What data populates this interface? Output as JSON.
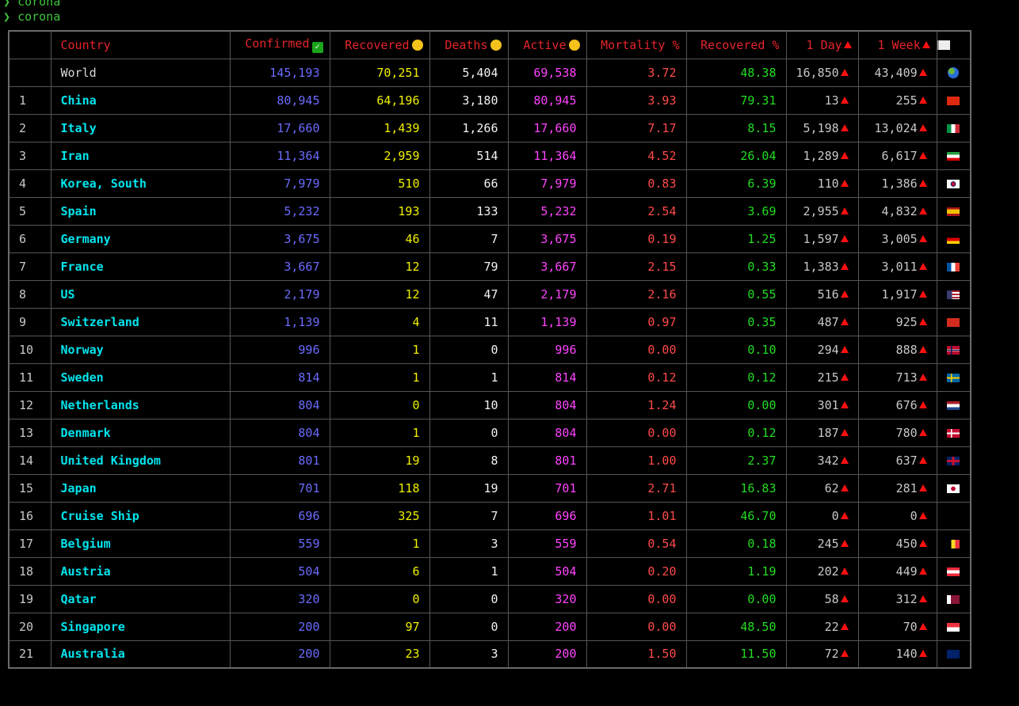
{
  "terminal": {
    "prompt_symbol": "❯",
    "lines": [
      "corona",
      "corona"
    ]
  },
  "table": {
    "headers": {
      "rank": "",
      "country": "Country",
      "confirmed": "Confirmed",
      "confirmed_icon": "check-mark-icon",
      "recovered": "Recovered",
      "recovered_icon": "smiley-face-icon",
      "deaths": "Deaths",
      "deaths_icon": "sad-face-icon",
      "active": "Active",
      "active_icon": "mask-face-icon",
      "mortality": "Mortality %",
      "recovered_pct": "Recovered %",
      "one_day": "1 Day",
      "one_week": "1 Week",
      "flag_icon": "white-flag-icon"
    },
    "rows": [
      {
        "rank": "",
        "country": "World",
        "confirmed": "145,193",
        "recovered": "70,251",
        "deaths": "5,404",
        "active": "69,538",
        "mortality": "3.72",
        "recovered_pct": "48.38",
        "day": "16,850",
        "week": "43,409",
        "flag": "globe"
      },
      {
        "rank": "1",
        "country": "China",
        "confirmed": "80,945",
        "recovered": "64,196",
        "deaths": "3,180",
        "active": "80,945",
        "mortality": "3.93",
        "recovered_pct": "79.31",
        "day": "13",
        "week": "255",
        "flag": "cn"
      },
      {
        "rank": "2",
        "country": "Italy",
        "confirmed": "17,660",
        "recovered": "1,439",
        "deaths": "1,266",
        "active": "17,660",
        "mortality": "7.17",
        "recovered_pct": "8.15",
        "day": "5,198",
        "week": "13,024",
        "flag": "it"
      },
      {
        "rank": "3",
        "country": "Iran",
        "confirmed": "11,364",
        "recovered": "2,959",
        "deaths": "514",
        "active": "11,364",
        "mortality": "4.52",
        "recovered_pct": "26.04",
        "day": "1,289",
        "week": "6,617",
        "flag": "ir"
      },
      {
        "rank": "4",
        "country": "Korea, South",
        "confirmed": "7,979",
        "recovered": "510",
        "deaths": "66",
        "active": "7,979",
        "mortality": "0.83",
        "recovered_pct": "6.39",
        "day": "110",
        "week": "1,386",
        "flag": "kr"
      },
      {
        "rank": "5",
        "country": "Spain",
        "confirmed": "5,232",
        "recovered": "193",
        "deaths": "133",
        "active": "5,232",
        "mortality": "2.54",
        "recovered_pct": "3.69",
        "day": "2,955",
        "week": "4,832",
        "flag": "es"
      },
      {
        "rank": "6",
        "country": "Germany",
        "confirmed": "3,675",
        "recovered": "46",
        "deaths": "7",
        "active": "3,675",
        "mortality": "0.19",
        "recovered_pct": "1.25",
        "day": "1,597",
        "week": "3,005",
        "flag": "de"
      },
      {
        "rank": "7",
        "country": "France",
        "confirmed": "3,667",
        "recovered": "12",
        "deaths": "79",
        "active": "3,667",
        "mortality": "2.15",
        "recovered_pct": "0.33",
        "day": "1,383",
        "week": "3,011",
        "flag": "fr"
      },
      {
        "rank": "8",
        "country": "US",
        "confirmed": "2,179",
        "recovered": "12",
        "deaths": "47",
        "active": "2,179",
        "mortality": "2.16",
        "recovered_pct": "0.55",
        "day": "516",
        "week": "1,917",
        "flag": "us"
      },
      {
        "rank": "9",
        "country": "Switzerland",
        "confirmed": "1,139",
        "recovered": "4",
        "deaths": "11",
        "active": "1,139",
        "mortality": "0.97",
        "recovered_pct": "0.35",
        "day": "487",
        "week": "925",
        "flag": "ch"
      },
      {
        "rank": "10",
        "country": "Norway",
        "confirmed": "996",
        "recovered": "1",
        "deaths": "0",
        "active": "996",
        "mortality": "0.00",
        "recovered_pct": "0.10",
        "day": "294",
        "week": "888",
        "flag": "no"
      },
      {
        "rank": "11",
        "country": "Sweden",
        "confirmed": "814",
        "recovered": "1",
        "deaths": "1",
        "active": "814",
        "mortality": "0.12",
        "recovered_pct": "0.12",
        "day": "215",
        "week": "713",
        "flag": "se"
      },
      {
        "rank": "12",
        "country": "Netherlands",
        "confirmed": "804",
        "recovered": "0",
        "deaths": "10",
        "active": "804",
        "mortality": "1.24",
        "recovered_pct": "0.00",
        "day": "301",
        "week": "676",
        "flag": "nl"
      },
      {
        "rank": "13",
        "country": "Denmark",
        "confirmed": "804",
        "recovered": "1",
        "deaths": "0",
        "active": "804",
        "mortality": "0.00",
        "recovered_pct": "0.12",
        "day": "187",
        "week": "780",
        "flag": "dk"
      },
      {
        "rank": "14",
        "country": "United Kingdom",
        "confirmed": "801",
        "recovered": "19",
        "deaths": "8",
        "active": "801",
        "mortality": "1.00",
        "recovered_pct": "2.37",
        "day": "342",
        "week": "637",
        "flag": "gb"
      },
      {
        "rank": "15",
        "country": "Japan",
        "confirmed": "701",
        "recovered": "118",
        "deaths": "19",
        "active": "701",
        "mortality": "2.71",
        "recovered_pct": "16.83",
        "day": "62",
        "week": "281",
        "flag": "jp"
      },
      {
        "rank": "16",
        "country": "Cruise Ship",
        "confirmed": "696",
        "recovered": "325",
        "deaths": "7",
        "active": "696",
        "mortality": "1.01",
        "recovered_pct": "46.70",
        "day": "0",
        "week": "0",
        "flag": ""
      },
      {
        "rank": "17",
        "country": "Belgium",
        "confirmed": "559",
        "recovered": "1",
        "deaths": "3",
        "active": "559",
        "mortality": "0.54",
        "recovered_pct": "0.18",
        "day": "245",
        "week": "450",
        "flag": "be"
      },
      {
        "rank": "18",
        "country": "Austria",
        "confirmed": "504",
        "recovered": "6",
        "deaths": "1",
        "active": "504",
        "mortality": "0.20",
        "recovered_pct": "1.19",
        "day": "202",
        "week": "449",
        "flag": "at"
      },
      {
        "rank": "19",
        "country": "Qatar",
        "confirmed": "320",
        "recovered": "0",
        "deaths": "0",
        "active": "320",
        "mortality": "0.00",
        "recovered_pct": "0.00",
        "day": "58",
        "week": "312",
        "flag": "qa"
      },
      {
        "rank": "20",
        "country": "Singapore",
        "confirmed": "200",
        "recovered": "97",
        "deaths": "0",
        "active": "200",
        "mortality": "0.00",
        "recovered_pct": "48.50",
        "day": "22",
        "week": "70",
        "flag": "sg"
      },
      {
        "rank": "21",
        "country": "Australia",
        "confirmed": "200",
        "recovered": "23",
        "deaths": "3",
        "active": "200",
        "mortality": "1.50",
        "recovered_pct": "11.50",
        "day": "72",
        "week": "140",
        "flag": "au"
      }
    ]
  },
  "colors": {
    "background": "#000000",
    "prompt": "#3ec43e",
    "header": "#e5242b",
    "country": "#00e5ee",
    "confirmed": "#6b6bff",
    "recovered": "#f0f000",
    "deaths": "#f2f2f2",
    "active": "#ff44ff",
    "mortality": "#ff4a4a",
    "recovered_pct": "#22dd22",
    "trend_up": "#ff1010"
  }
}
